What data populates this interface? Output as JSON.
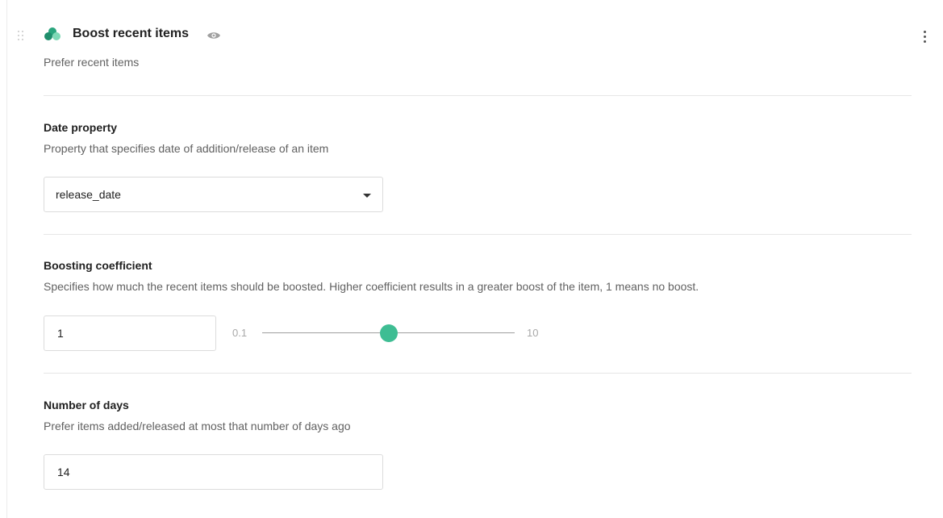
{
  "block": {
    "title": "Boost recent items",
    "subtitle": "Prefer recent items"
  },
  "icons": {
    "drag": "drag-handle-icon",
    "logo": "logo-icon",
    "visibility": "eye-icon",
    "more": "more-vertical-icon",
    "dropdown": "chevron-down-icon"
  },
  "date_property": {
    "title": "Date property",
    "description": "Property that specifies date of addition/release of an item",
    "selected_value": "release_date"
  },
  "boosting_coefficient": {
    "title": "Boosting coefficient",
    "description": "Specifies how much the recent items should be boosted. Higher coefficient results in a greater boost of the item, 1 means no boost.",
    "value": "1",
    "slider_min_label": "0.1",
    "slider_max_label": "10",
    "slider_fraction": 0.5
  },
  "number_of_days": {
    "title": "Number of days",
    "description": "Prefer items added/released at most that number of days ago",
    "value": "14"
  },
  "colors": {
    "accent": "#3ebd93",
    "logo_dark": "#1f8e6c",
    "logo_light": "#7fd9b6"
  }
}
